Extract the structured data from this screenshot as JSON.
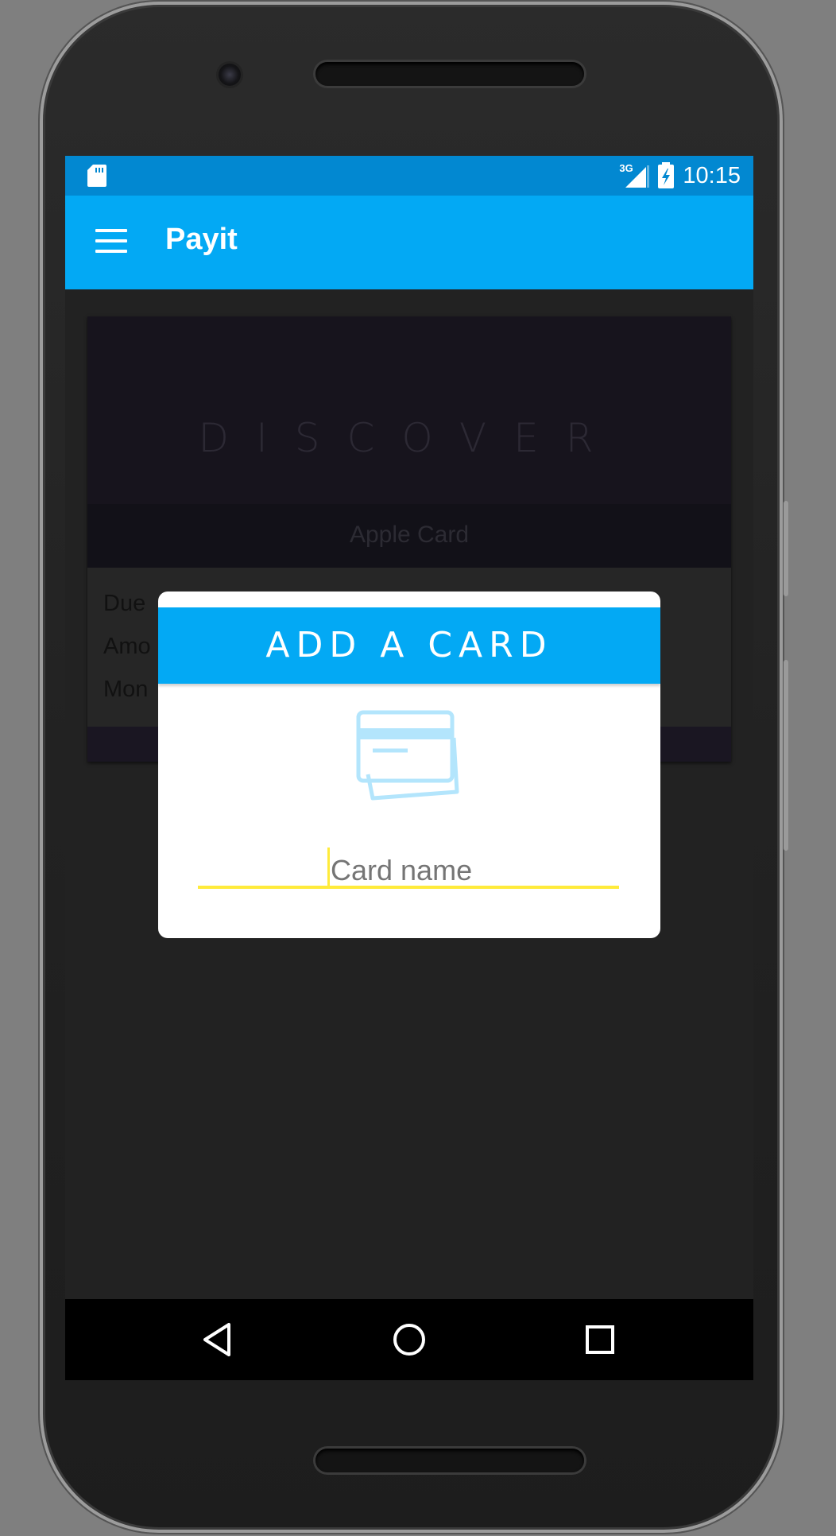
{
  "status_bar": {
    "time": "10:15",
    "network": "3G",
    "icons": [
      "sd-card-icon",
      "signal-icon",
      "battery-charging-icon"
    ]
  },
  "app_bar": {
    "title": "Payit",
    "menu_icon": "menu-icon"
  },
  "card": {
    "brand": "DISCOVER",
    "name": "Apple Card",
    "rows": [
      "Due",
      "Amo",
      "Mon"
    ]
  },
  "dialog": {
    "title": "ADD A CARD",
    "icon": "credit-card-icon",
    "field_placeholder": "Card name",
    "field_value": ""
  },
  "nav_bar": {
    "buttons": [
      "back-icon",
      "home-icon",
      "recents-icon"
    ]
  },
  "colors": {
    "primary": "#03a9f4",
    "primary_dark": "#0288d1",
    "accent": "#ffeb3b",
    "background": "#222222"
  }
}
